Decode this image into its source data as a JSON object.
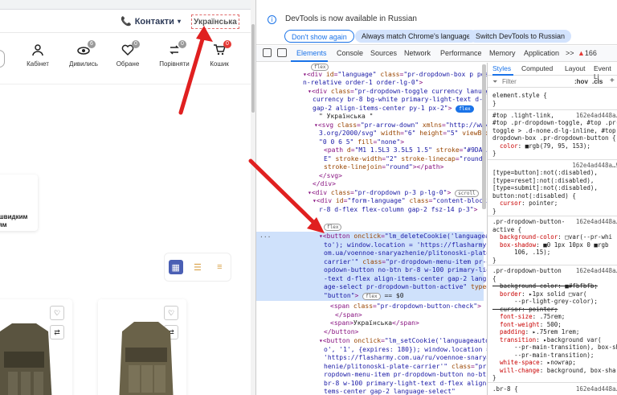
{
  "site": {
    "contacts_label": "Контакти",
    "language_label": "Українська",
    "header_icons": [
      {
        "label": "Кабінет",
        "badge": ""
      },
      {
        "label": "Дивились",
        "badge": "6"
      },
      {
        "label": "Обране",
        "badge": "0"
      },
      {
        "label": "Порівняти",
        "badge": "0"
      },
      {
        "label": "Кошик",
        "badge": "0"
      }
    ],
    "card_small_text": "швидким\nям"
  },
  "devtools": {
    "notice": "DevTools is now available in Russian",
    "btn_dont_show": "Don't show again",
    "btn_match": "Always match Chrome's language",
    "btn_switch": "Switch DevTools to Russian",
    "tabs": [
      "Elements",
      "Console",
      "Sources",
      "Network",
      "Performance",
      "Memory",
      "Application",
      ">>"
    ],
    "warn_count": "166",
    "styles_tabs": [
      "Styles",
      "Computed",
      "Layout",
      "Event Li"
    ],
    "filter_placeholder": "Filter",
    "filter_hov": ":hov",
    "filter_cls": ".cls"
  },
  "colors": {
    "accent": "#1a73e8",
    "arrow": "#e02020",
    "select_bg": "#cfe1fb"
  }
}
